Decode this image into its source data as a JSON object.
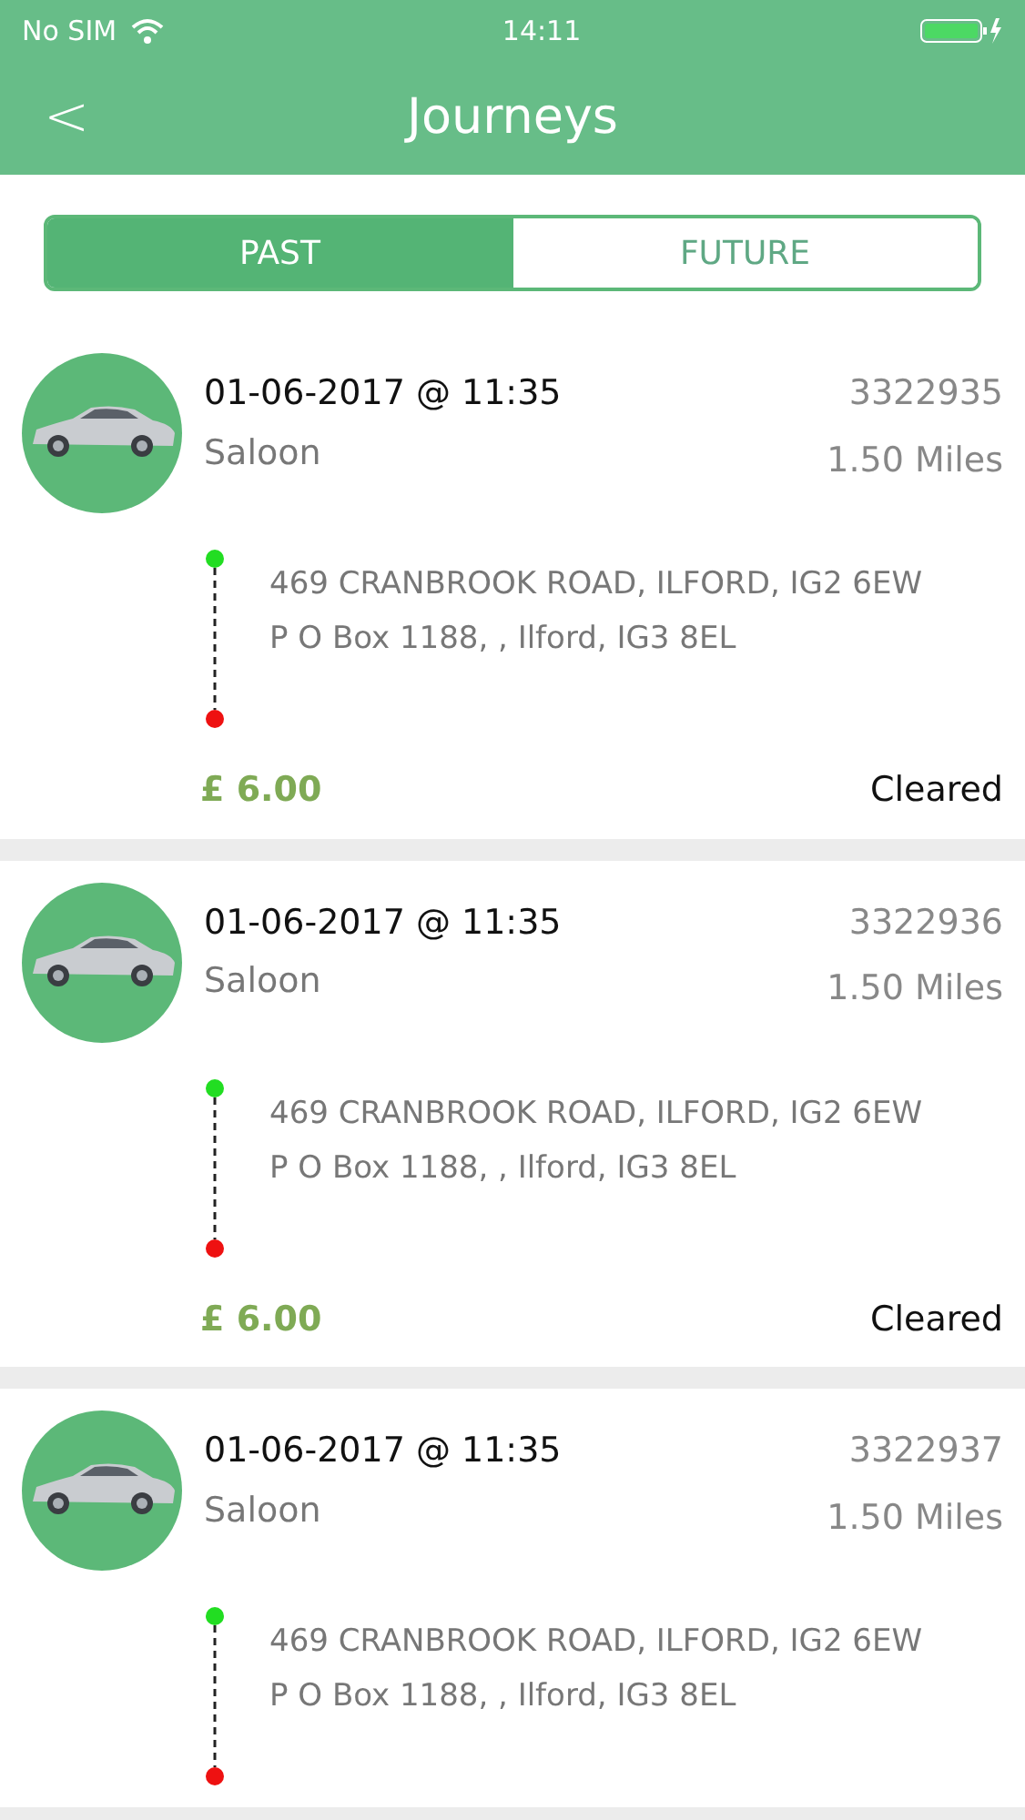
{
  "status_bar": {
    "carrier": "No SIM",
    "time": "14:11"
  },
  "nav": {
    "back": "<",
    "title": "Journeys"
  },
  "tabs": [
    {
      "label": "PAST",
      "selected": true
    },
    {
      "label": "FUTURE",
      "selected": false
    }
  ],
  "journeys": [
    {
      "datetime": "01-06-2017 @ 11:35",
      "vehicle": "Saloon",
      "ref": "3322935",
      "distance": "1.50 Miles",
      "pickup": "469 CRANBROOK ROAD, ILFORD, IG2 6EW",
      "dropoff": "P O Box 1188, , Ilford, IG3 8EL",
      "price": "£ 6.00",
      "status": "Cleared"
    },
    {
      "datetime": "01-06-2017 @ 11:35",
      "vehicle": "Saloon",
      "ref": "3322936",
      "distance": "1.50 Miles",
      "pickup": "469 CRANBROOK ROAD, ILFORD, IG2 6EW",
      "dropoff": "P O Box 1188, , Ilford, IG3 8EL",
      "price": "£ 6.00",
      "status": "Cleared"
    },
    {
      "datetime": "01-06-2017 @ 11:35",
      "vehicle": "Saloon",
      "ref": "3322937",
      "distance": "1.50 Miles",
      "pickup": "469 CRANBROOK ROAD, ILFORD, IG2 6EW",
      "dropoff": "P O Box 1188, , Ilford, IG3 8EL"
    }
  ]
}
